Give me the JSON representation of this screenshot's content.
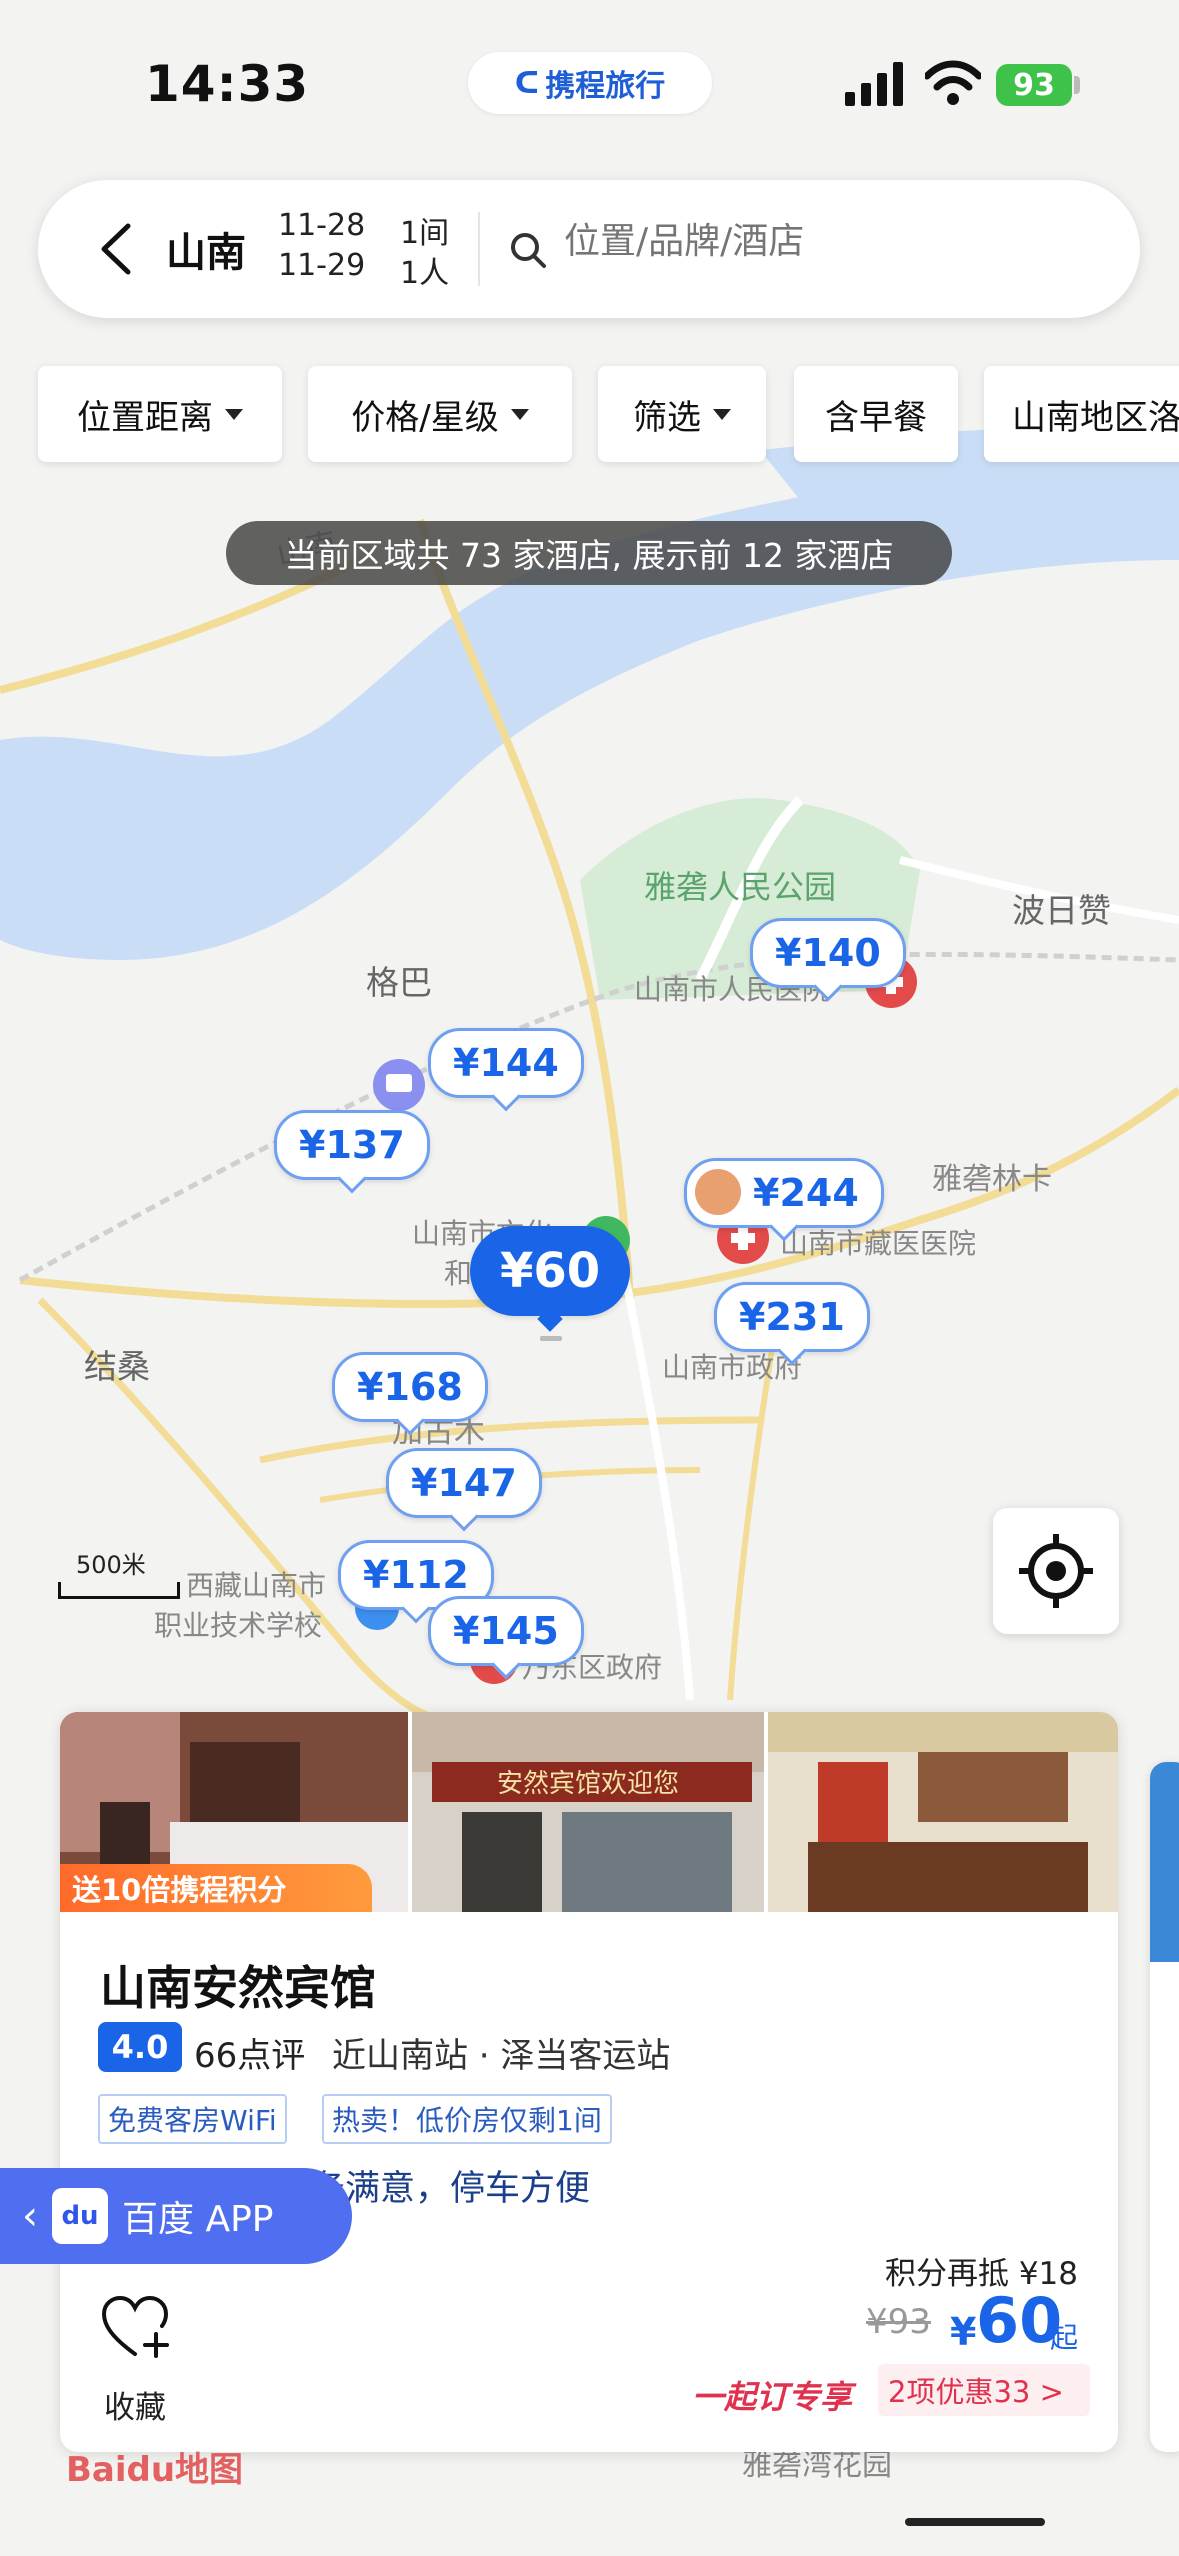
{
  "status_bar": {
    "time": "14:33",
    "app_name": "携程旅行",
    "battery": "93"
  },
  "search": {
    "city": "山南",
    "checkin": "11-28",
    "checkout": "11-29",
    "rooms": "1间",
    "guests": "1人",
    "placeholder": "位置/品牌/酒店"
  },
  "filters": [
    "位置距离",
    "价格/星级",
    "筛选",
    "含早餐",
    "山南地区洛"
  ],
  "info_text": "当前区域共 73 家酒店, 展示前 12 家酒店",
  "map": {
    "labels": {
      "park": "雅砻人民公园",
      "bori": "波日赞",
      "geba": "格巴",
      "hospital": "山南市人民医院",
      "yalong_linka": "雅砻林卡",
      "culture_center": "山南市文化",
      "culture_center2": "和",
      "tibetan_hospital": "山南市藏医医院",
      "gov": "山南市政府",
      "jiesang": "结桑",
      "jiagumu": "加古木",
      "school1": "西藏山南市",
      "school2": "职业技术学校",
      "district_gov": "乃东区政府",
      "road": "山南",
      "flower": "雅砻湾花园",
      "scale": "500米"
    },
    "markers": [
      "¥140",
      "¥144",
      "¥137",
      "¥244",
      "¥60",
      "¥231",
      "¥168",
      "¥147",
      "¥112",
      "¥145"
    ]
  },
  "hotel": {
    "promo": "送10倍携程积分",
    "name": "山南安然宾馆",
    "rating": "4.0",
    "reviews": "66点评",
    "location": "近山南站 · 泽当客运站",
    "tags": [
      "免费客房WiFi",
      "热卖！低价房仅剩1间"
    ],
    "desc": "卫生干净，服务满意，停车方便",
    "points_offset": "积分再抵 ¥18",
    "original_price": "¥93",
    "currency": "¥",
    "price": "60",
    "price_suffix": "起",
    "favorite_label": "收藏",
    "group_deal": "一起订专享",
    "deals": "2项优惠33 >",
    "photo_sign": "安然宾馆欢迎您"
  },
  "baidu_button": {
    "label": "百度 APP",
    "logo": "du"
  },
  "watermark": "Baidu地图"
}
